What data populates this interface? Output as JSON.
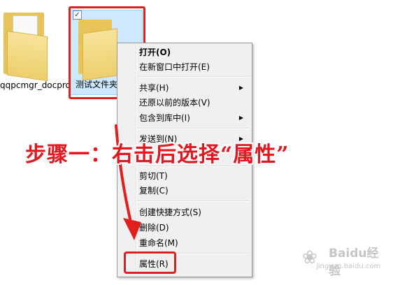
{
  "items": {
    "folder1_label": "qqpcmgr_docpro",
    "folder2_label": "测试文件夹",
    "checkbox_mark": "✓"
  },
  "context_menu": {
    "items": [
      {
        "label": "打开(O)",
        "bold": true
      },
      {
        "label": "在新窗口中打开(E)"
      },
      {
        "label": "共享(H)",
        "submenu": true
      },
      {
        "label": "还原以前的版本(V)"
      },
      {
        "label": "包含到库中(I)",
        "submenu": true
      },
      {
        "label": "发送到(N)",
        "submenu": true
      },
      {
        "label": "剪切(T)"
      },
      {
        "label": "复制(C)"
      },
      {
        "label": "创建快捷方式(S)"
      },
      {
        "label": "删除(D)"
      },
      {
        "label": "重命名(M)"
      },
      {
        "label": "属性(R)"
      }
    ],
    "submenu_arrow": "▶"
  },
  "annotation": "步骤一：右击后选择“属性”",
  "watermark": {
    "main": "Baidu经验",
    "sub": "jingyan.baidu.com"
  },
  "colors": {
    "highlight_red": "#e0201f",
    "selection_blue": "#cde8ff",
    "menu_bg": "#f0f0f0"
  }
}
